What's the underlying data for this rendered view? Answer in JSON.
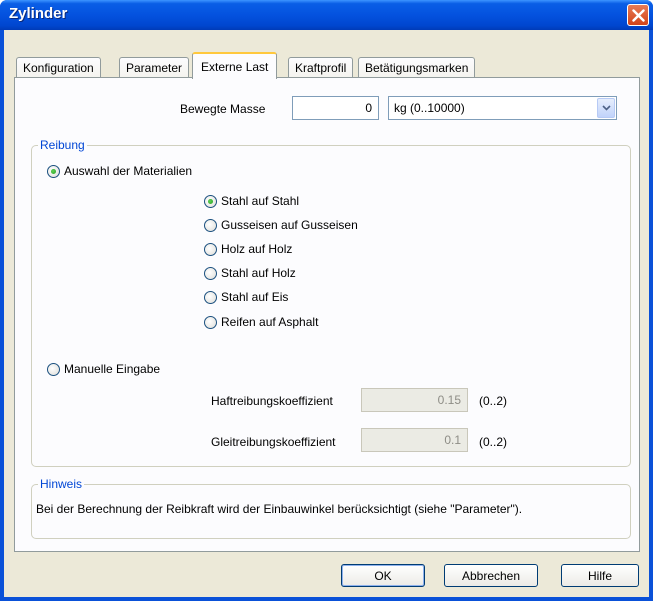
{
  "window": {
    "title": "Zylinder"
  },
  "tabs": [
    "Konfiguration",
    "Parameter",
    "Externe Last",
    "Kraftprofil",
    "Betätigungsmarken"
  ],
  "load": {
    "mass_label": "Bewegte Masse",
    "mass_value": "0",
    "unit_selected": "kg (0..10000)"
  },
  "friction": {
    "group_title": "Reibung",
    "material_mode_label": "Auswahl der Materialien",
    "materials": [
      "Stahl auf Stahl",
      "Gusseisen auf Gusseisen",
      "Holz auf Holz",
      "Stahl auf Holz",
      "Stahl auf Eis",
      "Reifen auf Asphalt"
    ],
    "selected_material": "Stahl auf Stahl",
    "manual_mode_label": "Manuelle Eingabe",
    "static_label": "Haftreibungskoeffizient",
    "static_value": "0.15",
    "static_range": "(0..2)",
    "sliding_label": "Gleitreibungskoeffizient",
    "sliding_value": "0.1",
    "sliding_range": "(0..2)"
  },
  "hint": {
    "group_title": "Hinweis",
    "text": "Bei der Berechnung der Reibkraft wird der Einbauwinkel berücksichtigt (siehe \"Parameter\")."
  },
  "buttons": {
    "ok": "OK",
    "cancel": "Abbrechen",
    "help": "Hilfe"
  },
  "colors": {
    "titlebar": "#0452df",
    "dialog_bg": "#ece9d8",
    "group_title": "#0046d5",
    "active_tab_accent": "#ffc83c"
  }
}
